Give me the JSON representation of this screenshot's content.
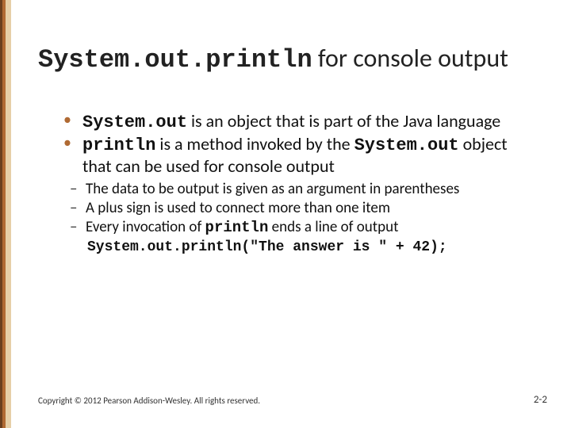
{
  "title": {
    "code": "System.out.println",
    "rest": " for console output"
  },
  "bullets": {
    "b1": {
      "code1": "System.out",
      "t1": " is an object that is part of the Java language"
    },
    "b2": {
      "code1": "println",
      "t1": " is a method invoked by the ",
      "code2": "System.out",
      "t2": " object that can be used for console output"
    }
  },
  "sub": {
    "s1": "The data to be output is given as an argument in parentheses",
    "s2": "A plus sign is used to connect more than one item",
    "s3a": "Every invocation of ",
    "s3code": "println",
    "s3b": " ends a line of output"
  },
  "code_example": "System.out.println(\"The answer is \" + 42);",
  "footer": {
    "copyright": "Copyright © 2012 Pearson Addison-Wesley. All rights reserved.",
    "page": "2-2"
  }
}
